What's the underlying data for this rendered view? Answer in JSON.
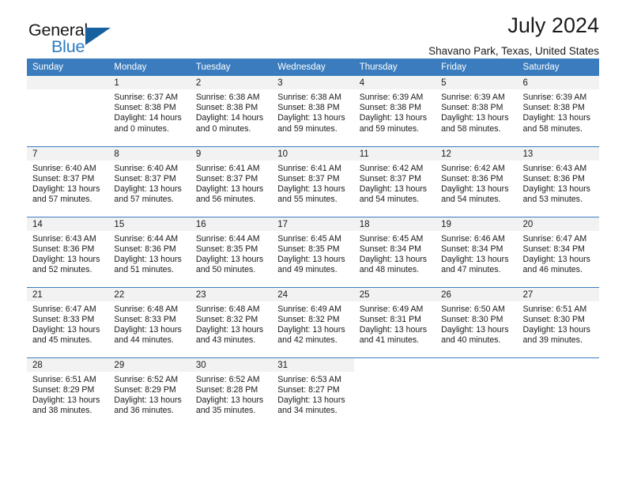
{
  "logo": {
    "word_one": "General",
    "word_two": "Blue",
    "triangle_color": "#17619e",
    "blue_color": "#2b7cc4"
  },
  "header": {
    "title": "July 2024",
    "subtitle": "Shavano Park, Texas, United States"
  },
  "theme": {
    "header_blue": "#3a7cbe",
    "daynum_band": "#f2f2f2",
    "text": "#1a1a1a"
  },
  "weekdays": [
    "Sunday",
    "Monday",
    "Tuesday",
    "Wednesday",
    "Thursday",
    "Friday",
    "Saturday"
  ],
  "weeks": [
    [
      {
        "day": "",
        "lines": [
          "",
          "",
          "",
          ""
        ],
        "state": "empty"
      },
      {
        "day": "1",
        "lines": [
          "Sunrise: 6:37 AM",
          "Sunset: 8:38 PM",
          "Daylight: 14 hours",
          "and 0 minutes."
        ],
        "state": "filled"
      },
      {
        "day": "2",
        "lines": [
          "Sunrise: 6:38 AM",
          "Sunset: 8:38 PM",
          "Daylight: 14 hours",
          "and 0 minutes."
        ],
        "state": "filled"
      },
      {
        "day": "3",
        "lines": [
          "Sunrise: 6:38 AM",
          "Sunset: 8:38 PM",
          "Daylight: 13 hours",
          "and 59 minutes."
        ],
        "state": "filled"
      },
      {
        "day": "4",
        "lines": [
          "Sunrise: 6:39 AM",
          "Sunset: 8:38 PM",
          "Daylight: 13 hours",
          "and 59 minutes."
        ],
        "state": "filled"
      },
      {
        "day": "5",
        "lines": [
          "Sunrise: 6:39 AM",
          "Sunset: 8:38 PM",
          "Daylight: 13 hours",
          "and 58 minutes."
        ],
        "state": "filled"
      },
      {
        "day": "6",
        "lines": [
          "Sunrise: 6:39 AM",
          "Sunset: 8:38 PM",
          "Daylight: 13 hours",
          "and 58 minutes."
        ],
        "state": "filled"
      }
    ],
    [
      {
        "day": "7",
        "lines": [
          "Sunrise: 6:40 AM",
          "Sunset: 8:37 PM",
          "Daylight: 13 hours",
          "and 57 minutes."
        ],
        "state": "filled"
      },
      {
        "day": "8",
        "lines": [
          "Sunrise: 6:40 AM",
          "Sunset: 8:37 PM",
          "Daylight: 13 hours",
          "and 57 minutes."
        ],
        "state": "filled"
      },
      {
        "day": "9",
        "lines": [
          "Sunrise: 6:41 AM",
          "Sunset: 8:37 PM",
          "Daylight: 13 hours",
          "and 56 minutes."
        ],
        "state": "filled"
      },
      {
        "day": "10",
        "lines": [
          "Sunrise: 6:41 AM",
          "Sunset: 8:37 PM",
          "Daylight: 13 hours",
          "and 55 minutes."
        ],
        "state": "filled"
      },
      {
        "day": "11",
        "lines": [
          "Sunrise: 6:42 AM",
          "Sunset: 8:37 PM",
          "Daylight: 13 hours",
          "and 54 minutes."
        ],
        "state": "filled"
      },
      {
        "day": "12",
        "lines": [
          "Sunrise: 6:42 AM",
          "Sunset: 8:36 PM",
          "Daylight: 13 hours",
          "and 54 minutes."
        ],
        "state": "filled"
      },
      {
        "day": "13",
        "lines": [
          "Sunrise: 6:43 AM",
          "Sunset: 8:36 PM",
          "Daylight: 13 hours",
          "and 53 minutes."
        ],
        "state": "filled"
      }
    ],
    [
      {
        "day": "14",
        "lines": [
          "Sunrise: 6:43 AM",
          "Sunset: 8:36 PM",
          "Daylight: 13 hours",
          "and 52 minutes."
        ],
        "state": "filled"
      },
      {
        "day": "15",
        "lines": [
          "Sunrise: 6:44 AM",
          "Sunset: 8:36 PM",
          "Daylight: 13 hours",
          "and 51 minutes."
        ],
        "state": "filled"
      },
      {
        "day": "16",
        "lines": [
          "Sunrise: 6:44 AM",
          "Sunset: 8:35 PM",
          "Daylight: 13 hours",
          "and 50 minutes."
        ],
        "state": "filled"
      },
      {
        "day": "17",
        "lines": [
          "Sunrise: 6:45 AM",
          "Sunset: 8:35 PM",
          "Daylight: 13 hours",
          "and 49 minutes."
        ],
        "state": "filled"
      },
      {
        "day": "18",
        "lines": [
          "Sunrise: 6:45 AM",
          "Sunset: 8:34 PM",
          "Daylight: 13 hours",
          "and 48 minutes."
        ],
        "state": "filled"
      },
      {
        "day": "19",
        "lines": [
          "Sunrise: 6:46 AM",
          "Sunset: 8:34 PM",
          "Daylight: 13 hours",
          "and 47 minutes."
        ],
        "state": "filled"
      },
      {
        "day": "20",
        "lines": [
          "Sunrise: 6:47 AM",
          "Sunset: 8:34 PM",
          "Daylight: 13 hours",
          "and 46 minutes."
        ],
        "state": "filled"
      }
    ],
    [
      {
        "day": "21",
        "lines": [
          "Sunrise: 6:47 AM",
          "Sunset: 8:33 PM",
          "Daylight: 13 hours",
          "and 45 minutes."
        ],
        "state": "filled"
      },
      {
        "day": "22",
        "lines": [
          "Sunrise: 6:48 AM",
          "Sunset: 8:33 PM",
          "Daylight: 13 hours",
          "and 44 minutes."
        ],
        "state": "filled"
      },
      {
        "day": "23",
        "lines": [
          "Sunrise: 6:48 AM",
          "Sunset: 8:32 PM",
          "Daylight: 13 hours",
          "and 43 minutes."
        ],
        "state": "filled"
      },
      {
        "day": "24",
        "lines": [
          "Sunrise: 6:49 AM",
          "Sunset: 8:32 PM",
          "Daylight: 13 hours",
          "and 42 minutes."
        ],
        "state": "filled"
      },
      {
        "day": "25",
        "lines": [
          "Sunrise: 6:49 AM",
          "Sunset: 8:31 PM",
          "Daylight: 13 hours",
          "and 41 minutes."
        ],
        "state": "filled"
      },
      {
        "day": "26",
        "lines": [
          "Sunrise: 6:50 AM",
          "Sunset: 8:30 PM",
          "Daylight: 13 hours",
          "and 40 minutes."
        ],
        "state": "filled"
      },
      {
        "day": "27",
        "lines": [
          "Sunrise: 6:51 AM",
          "Sunset: 8:30 PM",
          "Daylight: 13 hours",
          "and 39 minutes."
        ],
        "state": "filled"
      }
    ],
    [
      {
        "day": "28",
        "lines": [
          "Sunrise: 6:51 AM",
          "Sunset: 8:29 PM",
          "Daylight: 13 hours",
          "and 38 minutes."
        ],
        "state": "filled"
      },
      {
        "day": "29",
        "lines": [
          "Sunrise: 6:52 AM",
          "Sunset: 8:29 PM",
          "Daylight: 13 hours",
          "and 36 minutes."
        ],
        "state": "filled"
      },
      {
        "day": "30",
        "lines": [
          "Sunrise: 6:52 AM",
          "Sunset: 8:28 PM",
          "Daylight: 13 hours",
          "and 35 minutes."
        ],
        "state": "filled"
      },
      {
        "day": "31",
        "lines": [
          "Sunrise: 6:53 AM",
          "Sunset: 8:27 PM",
          "Daylight: 13 hours",
          "and 34 minutes."
        ],
        "state": "filled"
      },
      {
        "day": "",
        "lines": [
          "",
          "",
          "",
          ""
        ],
        "state": "blank"
      },
      {
        "day": "",
        "lines": [
          "",
          "",
          "",
          ""
        ],
        "state": "blank"
      },
      {
        "day": "",
        "lines": [
          "",
          "",
          "",
          ""
        ],
        "state": "blank"
      }
    ]
  ]
}
